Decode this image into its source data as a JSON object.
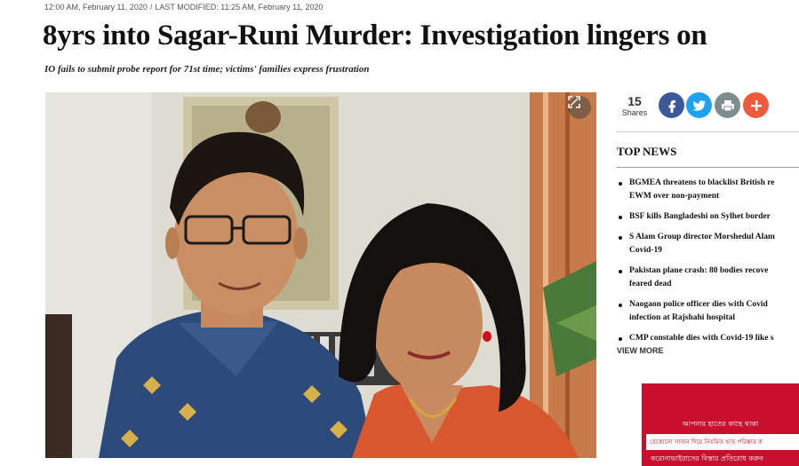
{
  "meta": {
    "published": "12:00 AM, February 11, 2020",
    "separator": "/",
    "modified": "LAST MODIFIED: 11:25 AM, February 11, 2020"
  },
  "article": {
    "headline": "8yrs into Sagar-Runi Murder: Investigation lingers on",
    "subheadline": "IO fails to submit probe report for 71st time; victims' families express frustration"
  },
  "share": {
    "count": "15",
    "label": "Shares",
    "buttons": [
      {
        "icon": "facebook-icon",
        "glyph": "f",
        "color": "#3b5998"
      },
      {
        "icon": "twitter-icon",
        "glyph": "t",
        "color": "#1da1f2"
      },
      {
        "icon": "print-icon",
        "glyph": "p",
        "color": "#7f8c8d"
      },
      {
        "icon": "plus-icon",
        "glyph": "+",
        "color": "#f05a3c"
      }
    ]
  },
  "photo": {
    "expand_icon": "expand-icon"
  },
  "top_news": {
    "title": "TOP NEWS",
    "items": [
      {
        "line1": "BGMEA threatens to blacklist British re",
        "line2": "EWM over non-payment"
      },
      {
        "line1": "BSF kills Bangladeshi on Sylhet border",
        "line2": ""
      },
      {
        "line1": "S Alam Group director Morshedul Alam",
        "line2": "Covid-19"
      },
      {
        "line1": "Pakistan plane crash: 80 bodies recove",
        "line2": "feared dead"
      },
      {
        "line1": "Naogaon police officer dies with Covid",
        "line2": "infection at Rajshahi hospital"
      },
      {
        "line1": "CMP constable dies with Covid-19 like s",
        "line2": ""
      }
    ],
    "view_more": "VIEW MORE"
  },
  "ad": {
    "line1": "আপনার হাতের কাছে থাকা",
    "line2": "যেকোনো সাবান দিয়ে নিয়মিত হাত পরিষ্কার ক",
    "line3": "করোনাভাইরাসের বিস্তার প্রতিরোধ করুন",
    "color": "#c8102e"
  }
}
